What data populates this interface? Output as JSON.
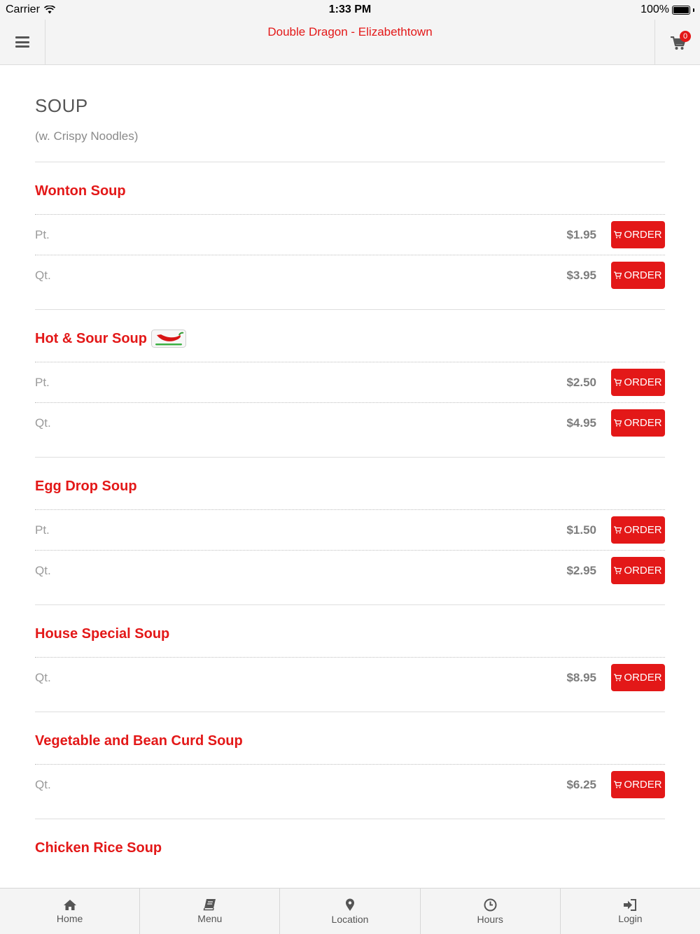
{
  "status_bar": {
    "carrier": "Carrier",
    "time": "1:33 PM",
    "battery": "100%"
  },
  "header": {
    "title": "Double Dragon - Elizabethtown",
    "cart_count": "0"
  },
  "category": {
    "title": "SOUP",
    "subtitle": "(w. Crispy Noodles)"
  },
  "order_label": "ORDER",
  "items": [
    {
      "name": "Wonton Soup",
      "spicy": false,
      "prices": [
        {
          "size": "Pt.",
          "price": "$1.95"
        },
        {
          "size": "Qt.",
          "price": "$3.95"
        }
      ]
    },
    {
      "name": "Hot & Sour Soup",
      "spicy": true,
      "prices": [
        {
          "size": "Pt.",
          "price": "$2.50"
        },
        {
          "size": "Qt.",
          "price": "$4.95"
        }
      ]
    },
    {
      "name": "Egg Drop Soup",
      "spicy": false,
      "prices": [
        {
          "size": "Pt.",
          "price": "$1.50"
        },
        {
          "size": "Qt.",
          "price": "$2.95"
        }
      ]
    },
    {
      "name": "House Special Soup",
      "spicy": false,
      "prices": [
        {
          "size": "Qt.",
          "price": "$8.95"
        }
      ]
    },
    {
      "name": "Vegetable and Bean Curd Soup",
      "spicy": false,
      "prices": [
        {
          "size": "Qt.",
          "price": "$6.25"
        }
      ]
    },
    {
      "name": "Chicken Rice Soup",
      "spicy": false,
      "prices": []
    }
  ],
  "tabs": [
    {
      "label": "Home",
      "icon": "home-icon"
    },
    {
      "label": "Menu",
      "icon": "book-icon"
    },
    {
      "label": "Location",
      "icon": "map-pin-icon"
    },
    {
      "label": "Hours",
      "icon": "clock-icon"
    },
    {
      "label": "Login",
      "icon": "sign-in-icon"
    }
  ],
  "colors": {
    "accent": "#e31818",
    "bar_bg": "#f4f4f4"
  }
}
